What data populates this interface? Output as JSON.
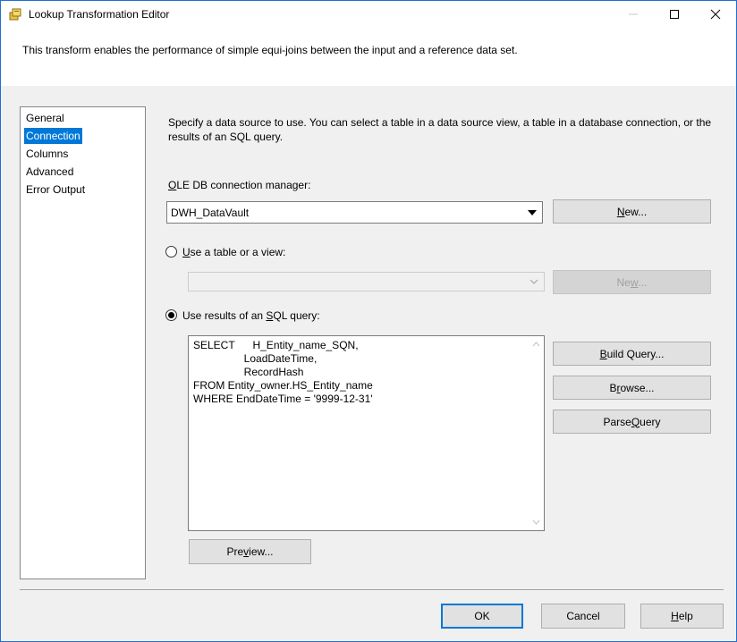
{
  "window": {
    "title": "Lookup Transformation Editor",
    "description": "This transform enables the performance of simple equi-joins between the input and a reference data set."
  },
  "nav": {
    "items": [
      {
        "label": "General",
        "selected": false
      },
      {
        "label": "Connection",
        "selected": true
      },
      {
        "label": "Columns",
        "selected": false
      },
      {
        "label": "Advanced",
        "selected": false
      },
      {
        "label": "Error Output",
        "selected": false
      }
    ]
  },
  "connection": {
    "intro": "Specify a data source to use. You can select a table in a data source view, a table in a database connection, or the results of an SQL query.",
    "ole_label": {
      "pre": "",
      "mnemonic": "O",
      "post": "LE DB connection manager:"
    },
    "ole_value": "DWH_DataVault",
    "new_button": {
      "pre": "",
      "mnemonic": "N",
      "post": "ew..."
    },
    "table_radio": {
      "pre": "",
      "mnemonic": "U",
      "post": "se a table or a view:",
      "checked": false
    },
    "table_value": "",
    "new_button2": {
      "pre": "Ne",
      "mnemonic": "w",
      "post": "..."
    },
    "sql_radio": {
      "pre": "Use results of an ",
      "mnemonic": "S",
      "post": "QL query:",
      "checked": true
    },
    "sql_query": "SELECT      H_Entity_name_SQN,\n                 LoadDateTime,\n                 RecordHash\nFROM Entity_owner.HS_Entity_name\nWHERE EndDateTime = '9999-12-31'",
    "build_query": {
      "pre": "",
      "mnemonic": "B",
      "post": "uild Query..."
    },
    "browse": {
      "pre": "B",
      "mnemonic": "r",
      "post": "owse..."
    },
    "parse_query": {
      "pre": "Parse ",
      "mnemonic": "Q",
      "post": "uery"
    },
    "preview": {
      "pre": "Pre",
      "mnemonic": "v",
      "post": "iew..."
    }
  },
  "footer": {
    "ok": "OK",
    "cancel": "Cancel",
    "help": {
      "pre": "",
      "mnemonic": "H",
      "post": "elp"
    }
  },
  "colors": {
    "selection": "#0078d7",
    "window_border": "#1f6fd6",
    "face": "#f0f0f0"
  }
}
